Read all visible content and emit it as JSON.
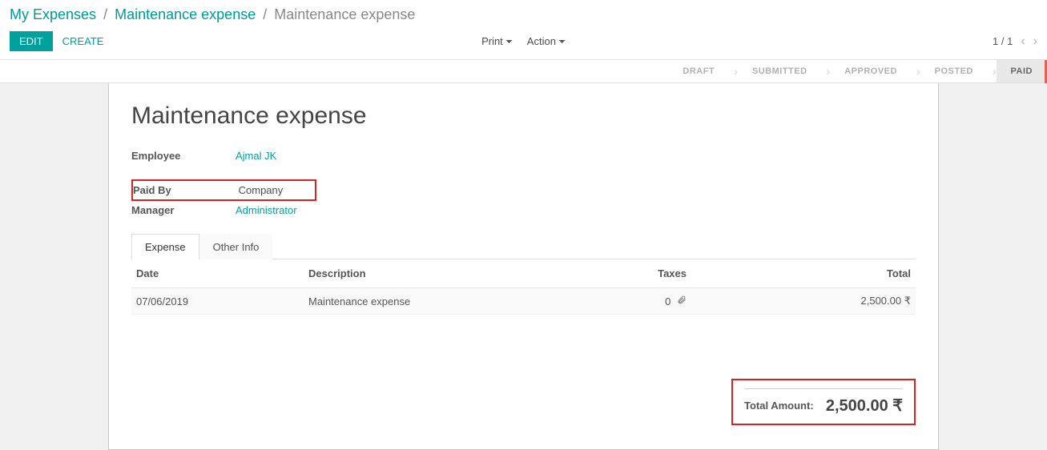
{
  "breadcrumb": {
    "root": "My Expenses",
    "parent": "Maintenance expense",
    "current": "Maintenance expense"
  },
  "toolbar": {
    "edit": "EDIT",
    "create": "CREATE",
    "print": "Print",
    "action": "Action"
  },
  "pager": {
    "text": "1 / 1"
  },
  "status": {
    "steps": [
      "DRAFT",
      "SUBMITTED",
      "APPROVED",
      "POSTED",
      "PAID"
    ],
    "active": "PAID"
  },
  "record": {
    "title": "Maintenance expense",
    "fields": {
      "employee_label": "Employee",
      "employee_value": "Ajmal JK",
      "paid_by_label": "Paid By",
      "paid_by_value": "Company",
      "manager_label": "Manager",
      "manager_value": "Administrator"
    }
  },
  "tabs": {
    "expense": "Expense",
    "other": "Other Info"
  },
  "table": {
    "headers": {
      "date": "Date",
      "description": "Description",
      "taxes": "Taxes",
      "total": "Total"
    },
    "rows": [
      {
        "date": "07/06/2019",
        "description": "Maintenance expense",
        "attach_count": "0",
        "total": "2,500.00 ₹"
      }
    ]
  },
  "totals": {
    "label": "Total Amount:",
    "value": "2,500.00 ₹"
  }
}
